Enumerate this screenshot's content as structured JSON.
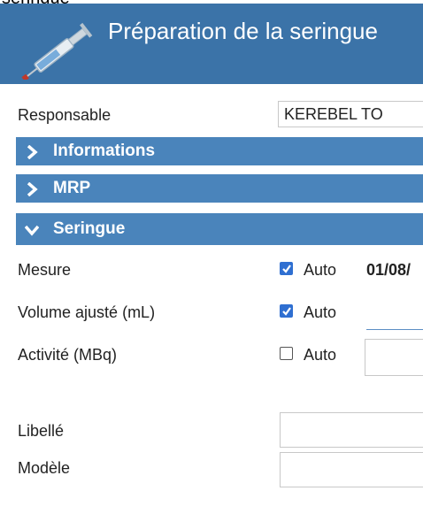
{
  "crop_text": "seringue",
  "header": {
    "title": "Préparation de la seringue",
    "icon": "syringe-icon"
  },
  "responsable": {
    "label": "Responsable",
    "value": "KEREBEL TO"
  },
  "sections": [
    {
      "label": "Informations",
      "expanded": false
    },
    {
      "label": "MRP",
      "expanded": false
    },
    {
      "label": "Seringue",
      "expanded": true
    }
  ],
  "seringue": {
    "mesure": {
      "label": "Mesure",
      "auto_checked": true,
      "auto_label": "Auto",
      "value": "01/08/"
    },
    "volume": {
      "label": "Volume ajusté (mL)",
      "auto_checked": true,
      "auto_label": "Auto",
      "value": ""
    },
    "activite": {
      "label": "Activité (MBq)",
      "auto_checked": false,
      "auto_label": "Auto",
      "value": ""
    }
  },
  "libelle": {
    "label": "Libellé",
    "value": ""
  },
  "modele": {
    "label": "Modèle",
    "value": ""
  },
  "colors": {
    "header_bg": "#3b73a8",
    "section_bg": "#4a84bb",
    "checkbox": "#2f6fd1"
  }
}
